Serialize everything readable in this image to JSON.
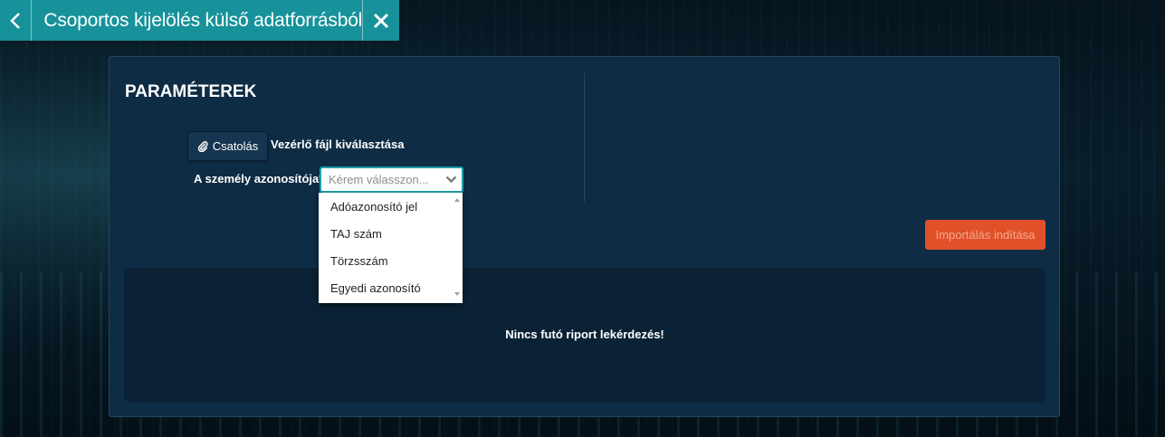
{
  "window": {
    "title": "Csoportos kijelölés külső adatforrásból",
    "back_icon": "chevron-left-icon",
    "close_icon": "close-icon"
  },
  "parameters": {
    "heading": "PARAMÉTEREK",
    "attach_button": {
      "label": "Csatolás",
      "icon": "paperclip-icon"
    },
    "attach_text": "Vezérlő fájl kiválasztása",
    "person_id_label": "A személy azonosítója*",
    "person_id_select": {
      "placeholder": "Kérem válasszon...",
      "options": [
        "Adóazonosító jel",
        "TAJ szám",
        "Törzsszám",
        "Egyedi azonosító"
      ]
    }
  },
  "import_button": {
    "label": "Importálás indítása",
    "color": "#e0512a"
  },
  "report": {
    "message": "Nincs futó riport lekérdezés!"
  },
  "colors": {
    "accent": "#17929a",
    "panel": "#0f2c45"
  }
}
